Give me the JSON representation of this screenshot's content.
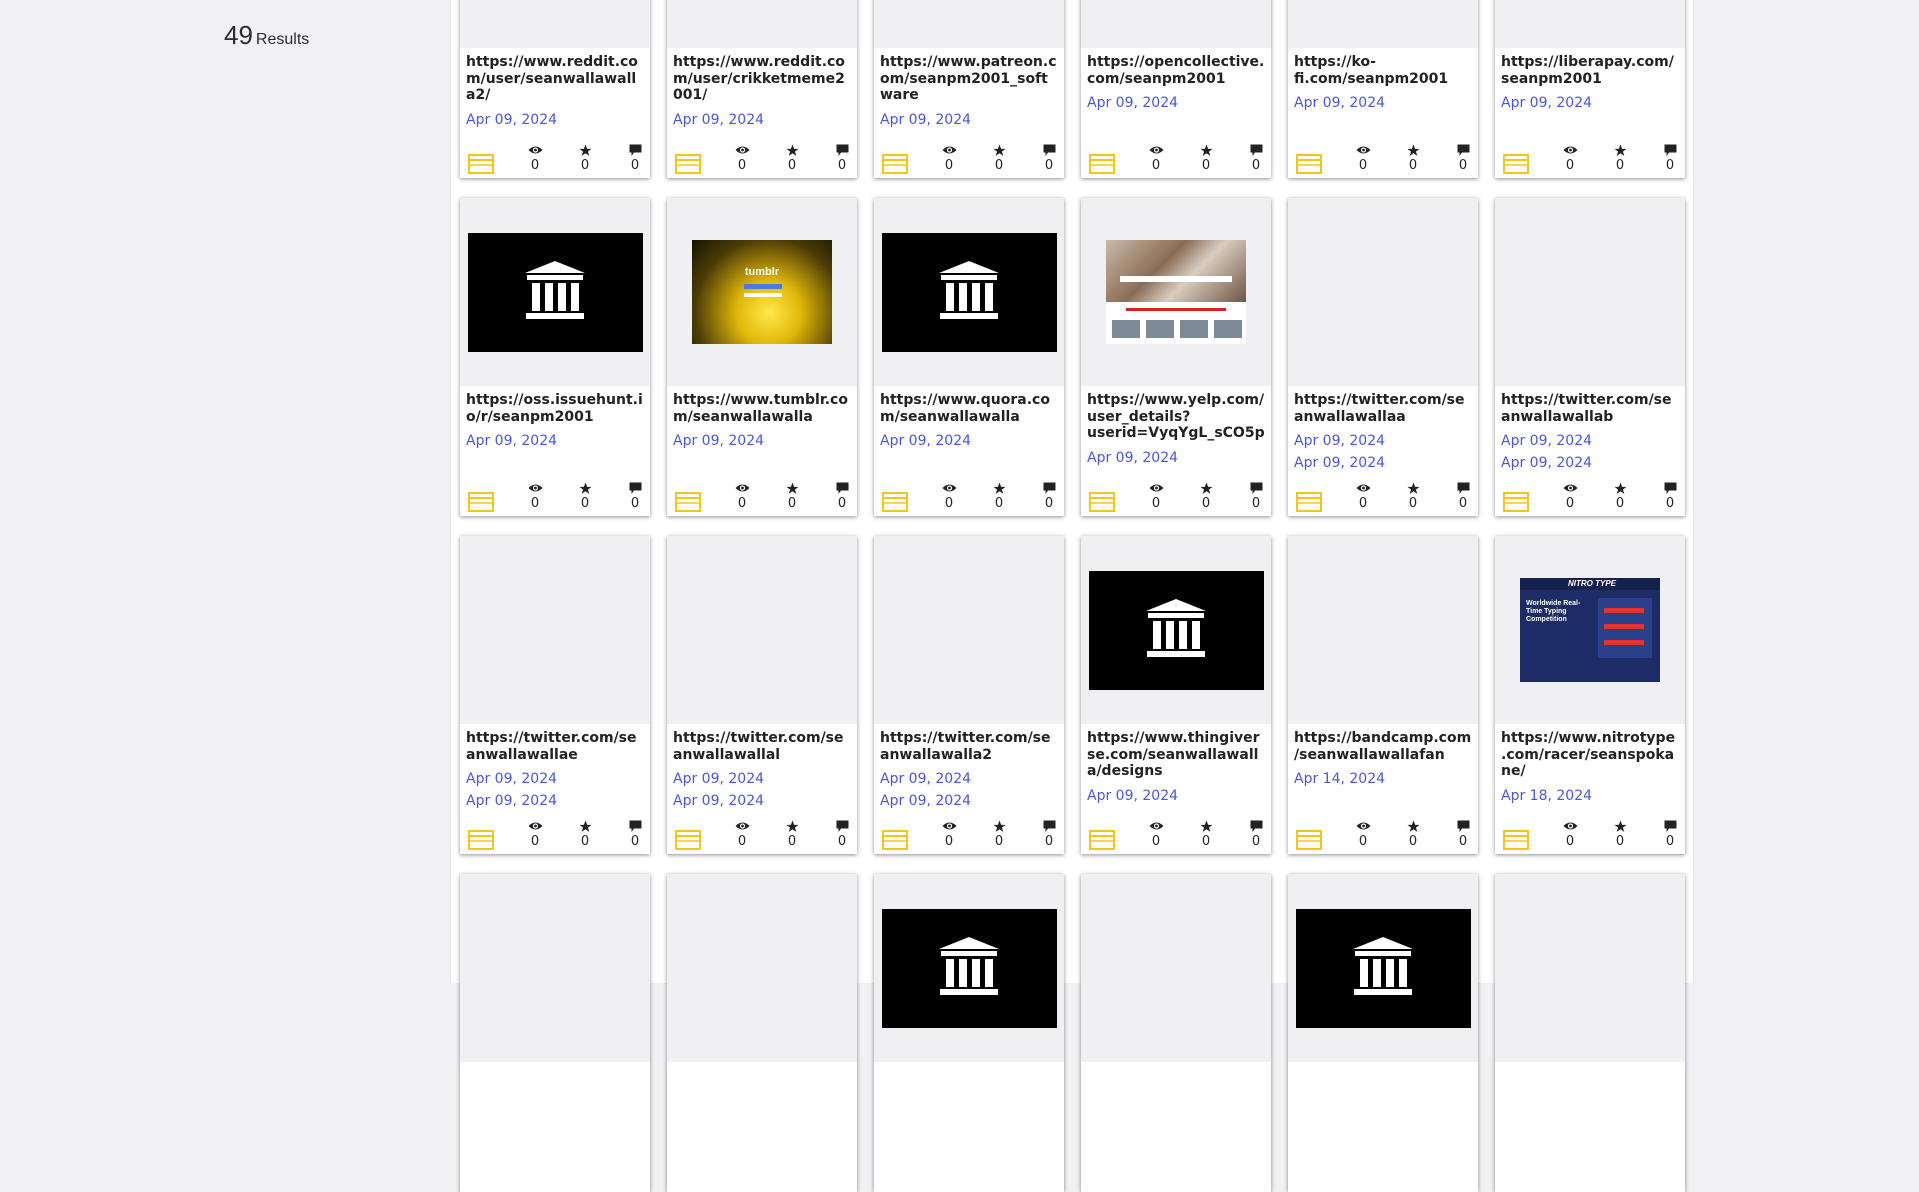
{
  "results": {
    "count": "49",
    "label": "Results"
  },
  "cards": [
    {
      "url": "https://www.reddit.com/user/seanwallawalla2/",
      "dates": [
        "Apr 09, 2024"
      ],
      "thumb": "page",
      "views": "0",
      "favorites": "0",
      "reviews": "0"
    },
    {
      "url": "https://www.reddit.com/user/crikketmeme2001/",
      "dates": [
        "Apr 09, 2024"
      ],
      "thumb": "page",
      "views": "0",
      "favorites": "0",
      "reviews": "0"
    },
    {
      "url": "https://www.patreon.com/seanpm2001_software",
      "dates": [
        "Apr 09, 2024"
      ],
      "thumb": "black",
      "views": "0",
      "favorites": "0",
      "reviews": "0"
    },
    {
      "url": "https://opencollective.com/seanpm2001",
      "dates": [
        "Apr 09, 2024"
      ],
      "thumb": "page",
      "views": "0",
      "favorites": "0",
      "reviews": "0"
    },
    {
      "url": "https://ko-fi.com/seanpm2001",
      "dates": [
        "Apr 09, 2024"
      ],
      "thumb": "page",
      "views": "0",
      "favorites": "0",
      "reviews": "0"
    },
    {
      "url": "https://liberapay.com/seanpm2001",
      "dates": [
        "Apr 09, 2024"
      ],
      "thumb": "page",
      "views": "0",
      "favorites": "0",
      "reviews": "0"
    },
    {
      "url": "https://oss.issuehunt.io/r/seanpm2001",
      "dates": [
        "Apr 09, 2024"
      ],
      "thumb": "archive",
      "views": "0",
      "favorites": "0",
      "reviews": "0"
    },
    {
      "url": "https://www.tumblr.com/seanwallawalla",
      "dates": [
        "Apr 09, 2024"
      ],
      "thumb": "tumblr",
      "views": "0",
      "favorites": "0",
      "reviews": "0"
    },
    {
      "url": "https://www.quora.com/seanwallawalla",
      "dates": [
        "Apr 09, 2024"
      ],
      "thumb": "archive",
      "views": "0",
      "favorites": "0",
      "reviews": "0"
    },
    {
      "url": "https://www.yelp.com/user_details?userid=VyqYgL_sCO5p...",
      "dates": [
        "Apr 09, 2024"
      ],
      "thumb": "yelp",
      "views": "0",
      "favorites": "0",
      "reviews": "0"
    },
    {
      "url": "https://twitter.com/seanwallawallaa",
      "dates": [
        "Apr 09, 2024",
        "Apr 09, 2024"
      ],
      "thumb": "blank",
      "views": "0",
      "favorites": "0",
      "reviews": "0"
    },
    {
      "url": "https://twitter.com/seanwallawallab",
      "dates": [
        "Apr 09, 2024",
        "Apr 09, 2024"
      ],
      "thumb": "blank",
      "views": "0",
      "favorites": "0",
      "reviews": "0"
    },
    {
      "url": "https://twitter.com/seanwallawallae",
      "dates": [
        "Apr 09, 2024",
        "Apr 09, 2024"
      ],
      "thumb": "blank",
      "views": "0",
      "favorites": "0",
      "reviews": "0"
    },
    {
      "url": "https://twitter.com/seanwallawallal",
      "dates": [
        "Apr 09, 2024",
        "Apr 09, 2024"
      ],
      "thumb": "blank",
      "views": "0",
      "favorites": "0",
      "reviews": "0"
    },
    {
      "url": "https://twitter.com/seanwallawalla2",
      "dates": [
        "Apr 09, 2024",
        "Apr 09, 2024"
      ],
      "thumb": "blank",
      "views": "0",
      "favorites": "0",
      "reviews": "0"
    },
    {
      "url": "https://www.thingiverse.com/seanwallawalla/designs",
      "dates": [
        "Apr 09, 2024"
      ],
      "thumb": "archive",
      "views": "0",
      "favorites": "0",
      "reviews": "0"
    },
    {
      "url": "https://bandcamp.com/seanwallawallafan",
      "dates": [
        "Apr 14, 2024"
      ],
      "thumb": "blank",
      "views": "0",
      "favorites": "0",
      "reviews": "0"
    },
    {
      "url": "https://www.nitrotype.com/racer/seanspokane/",
      "dates": [
        "Apr 18, 2024"
      ],
      "thumb": "nitro",
      "views": "0",
      "favorites": "0",
      "reviews": "0"
    },
    {
      "url": "",
      "dates": [],
      "thumb": "blank",
      "views": "",
      "favorites": "",
      "reviews": ""
    },
    {
      "url": "",
      "dates": [],
      "thumb": "blank",
      "views": "",
      "favorites": "",
      "reviews": ""
    },
    {
      "url": "",
      "dates": [],
      "thumb": "archive",
      "views": "",
      "favorites": "",
      "reviews": ""
    },
    {
      "url": "",
      "dates": [],
      "thumb": "blank",
      "views": "",
      "favorites": "",
      "reviews": ""
    },
    {
      "url": "",
      "dates": [],
      "thumb": "archive",
      "views": "",
      "favorites": "",
      "reviews": ""
    },
    {
      "url": "",
      "dates": [],
      "thumb": "blank",
      "views": "",
      "favorites": "",
      "reviews": ""
    }
  ],
  "thumb_text": {
    "tumblr": "tumblr",
    "nitro_logo": "NITRO TYPE",
    "nitro_headline": "Worldwide Real-Time Typing Competition"
  },
  "colors": {
    "date": "#4a56e2",
    "media_icon": "#f5c518",
    "page_bg": "#f1f1f4"
  },
  "icons": {
    "media": "texts-icon",
    "views": "eye-icon",
    "favorites": "star-icon",
    "reviews": "comment-icon",
    "archive": "archive-building-icon"
  }
}
